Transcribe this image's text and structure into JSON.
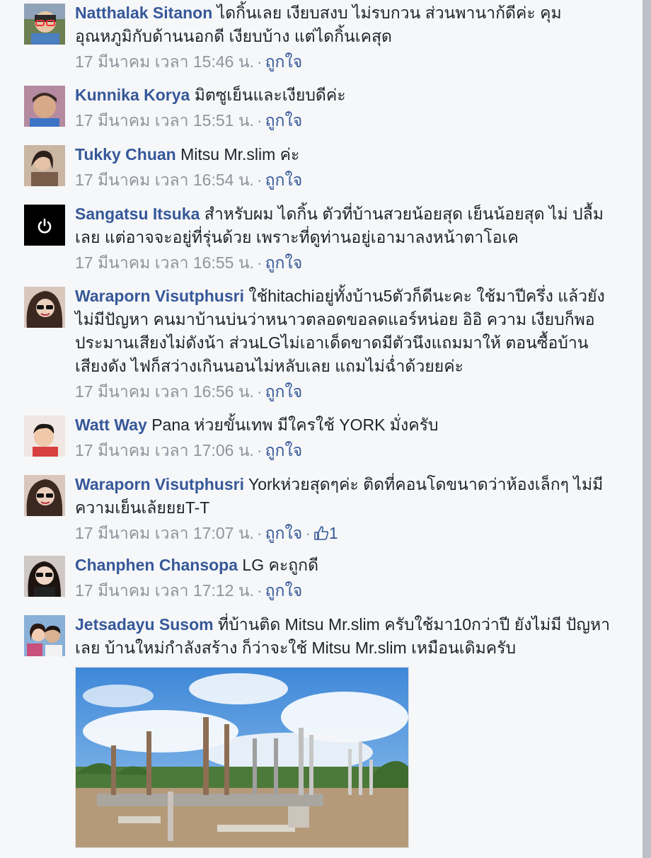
{
  "comments": [
    {
      "author": "Natthalak Sitanon",
      "text": "ไดกิ้นเลย เงียบสงบ ไม่รบกวน ส่วนพานาก้ดีค่ะ คุม อุณหภูมิกับด้านนอกดี เงียบบ้าง แต่ไดกิ้นเคสุด",
      "time": "17 มีนาคม เวลา 15:46 น.",
      "like_label": "ถูกใจ",
      "avatar_icon": "profile-photo-child-glasses"
    },
    {
      "author": "Kunnika Korya",
      "text": "มิตซูเย็นและเงียบดีค่ะ",
      "time": "17 มีนาคม เวลา 15:51 น.",
      "like_label": "ถูกใจ",
      "avatar_icon": "profile-photo-woman"
    },
    {
      "author": "Tukky Chuan",
      "text": "Mitsu Mr.slim ค่ะ",
      "time": "17 มีนาคม เวลา 16:54 น.",
      "like_label": "ถูกใจ",
      "avatar_icon": "profile-photo-woman"
    },
    {
      "author": "Sangatsu Itsuka",
      "text": "สำหรับผม ไดกิ้น ตัวที่บ้านสวยน้อยสุด เย็นน้อยสุด ไม่ ปลื้มเลย แต่อาจจะอยู่ที่รุ่นด้วย เพราะที่ดูท่านอยู่เอามาลงหน้าตาโอเค",
      "time": "17 มีนาคม เวลา 16:55 น.",
      "like_label": "ถูกใจ",
      "avatar_icon": "power-icon"
    },
    {
      "author": "Waraporn Visutphusri",
      "text": "ใช้hitachiอยู่ทั้งบ้าน5ตัวก็ดีนะคะ ใช้มาปีครึ่ง แล้วยังไม่มีปัญหา คนมาบ้านบ่นว่าหนาวตลอดขอลดแอร์หน่อย อิอิ ความ เงียบก็พอประมานเสียงไม่ดังน้า ส่วนLGไม่เอาเด็ดขาดมีตัวนึงแถมมาให้ ตอนซื้อบ้านเสียงดัง ไฟก็สว่างเกินนอนไม่หลับเลย แถมไม่ฉ่ำด้วยยค่ะ",
      "time": "17 มีนาคม เวลา 16:56 น.",
      "like_label": "ถูกใจ",
      "avatar_icon": "profile-photo-woman-sunglasses"
    },
    {
      "author": "Watt Way",
      "text": "Pana ห่วยขั้นเทพ มีใครใช้ YORK มั่งครับ",
      "time": "17 มีนาคม เวลา 17:06 น.",
      "like_label": "ถูกใจ",
      "avatar_icon": "profile-photo-man"
    },
    {
      "author": "Waraporn Visutphusri",
      "text": "Yorkห่วยสุดๆค่ะ ติดที่คอนโดขนาดว่าห้องเล็กๆ ไม่มีความเย็นเล้ยยยT-T",
      "time": "17 มีนาคม เวลา 17:07 น.",
      "like_label": "ถูกใจ",
      "like_count": "1",
      "avatar_icon": "profile-photo-woman-sunglasses"
    },
    {
      "author": "Chanphen Chansopa",
      "text": "LG คะถูกดี",
      "time": "17 มีนาคม เวลา 17:12 น.",
      "like_label": "ถูกใจ",
      "avatar_icon": "profile-photo-woman-sunglasses"
    },
    {
      "author": "Jetsadayu Susom",
      "text": "ที่บ้านติด Mitsu Mr.slim ครับใช้มา10กว่าปี ยังไม่มี ปัญหาเลย บ้านใหม่กำลังสร้าง ก็ว่าจะใช้ Mitsu Mr.slim เหมือนเดิมครับ",
      "avatar_icon": "profile-photo-couple",
      "photo": "construction-site-photo"
    }
  ],
  "colors": {
    "author": "#365899",
    "text": "#1d2129",
    "meta": "#90949c",
    "background": "#f6f7f9"
  }
}
